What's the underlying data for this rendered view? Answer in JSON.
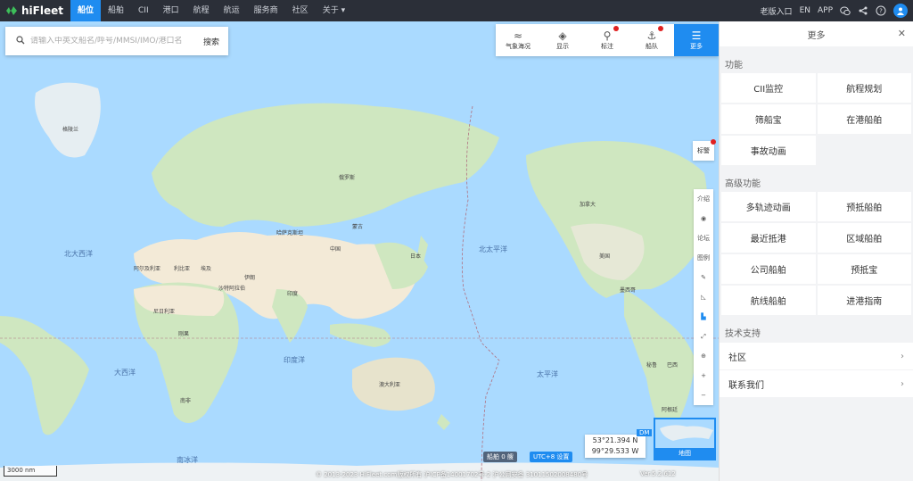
{
  "app": {
    "name": "hiFleet"
  },
  "nav": {
    "items": [
      "船位",
      "船舶",
      "CII",
      "港口",
      "航程",
      "航运",
      "服务商",
      "社区",
      "关于"
    ],
    "right": {
      "old_version": "老版入口",
      "lang": "EN",
      "app": "APP"
    }
  },
  "search": {
    "placeholder": "请输入中英文船名/呼号/MMSI/IMO/港口名",
    "button": "搜索"
  },
  "toolbar": [
    {
      "label": "气象海况",
      "icon": "wind-icon"
    },
    {
      "label": "显示",
      "icon": "layers-icon"
    },
    {
      "label": "标注",
      "icon": "pin-icon"
    },
    {
      "label": "船队",
      "icon": "fleet-icon"
    },
    {
      "label": "更多",
      "icon": "menu-icon"
    }
  ],
  "map_labels": {
    "oceans": [
      "北大西洋",
      "北太平洋",
      "大西洋",
      "印度洋",
      "太平洋",
      "南冰洋"
    ],
    "countries": [
      "格陵兰",
      "俄罗斯",
      "中国",
      "阿尔及利亚",
      "利比亚",
      "埃及",
      "尼日利亚",
      "刚果",
      "南非",
      "印度",
      "伊朗",
      "沙特阿拉伯",
      "澳大利亚",
      "加拿大",
      "美国",
      "墨西哥",
      "巴西",
      "秘鲁",
      "阿根廷",
      "哈萨克斯坦",
      "蒙古",
      "日本"
    ]
  },
  "side_tools": {
    "biaoji": "标警",
    "intro": "介绍",
    "forum": "论坛",
    "legend": "图例"
  },
  "bottom": {
    "scale": "3000 nm",
    "copyright": "© 2013-2023 HiFleet.com版权所有 沪ICP备14001702号-2 沪公网安备 31011502008480号",
    "version": "Ver.5.2.612",
    "ships": "船舶 0 艘",
    "timezone": "UTC+8 设置",
    "lat": "53°21.394 N",
    "lon": "99°29.533 W",
    "dm": "DM",
    "minimap_label": "地图"
  },
  "panel": {
    "title": "更多",
    "section1": "功能",
    "features": [
      "CII监控",
      "航程规划",
      "筛船宝",
      "在港船舶",
      "事故动画"
    ],
    "section2": "高级功能",
    "advanced": [
      "多轨迹动画",
      "预抵船舶",
      "最近抵港",
      "区域船舶",
      "公司船舶",
      "预抵宝",
      "航线船舶",
      "进港指南"
    ],
    "section3": "技术支持",
    "support": [
      "社区",
      "联系我们"
    ]
  },
  "colors": {
    "accent": "#1f8cf0",
    "topbar": "#2b2f38",
    "ocean": "#aadaff",
    "land": "#cfe7c0"
  }
}
